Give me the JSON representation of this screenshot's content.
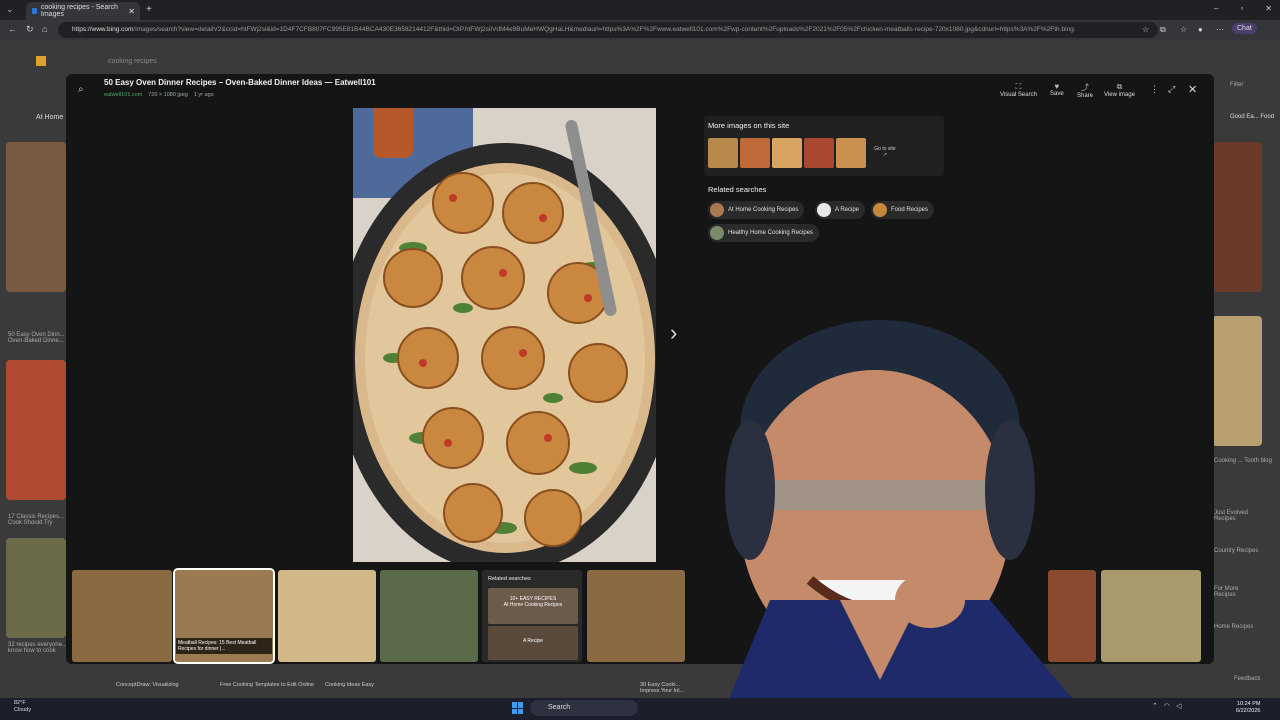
{
  "browser": {
    "tab_title": "cooking recipes - Search Images",
    "url_host": "https://www.bing.com",
    "url_path": "/images/search?view=detailV2&ccid=htFWj2si&id=1D4F7CFB807FC995E81B44BCA430E3658214412F&thid=OIP.htFWj2siIVdM4e9BuMeHWQgHaLH&mediaurl=https%3A%2F%2Fwww.eatwell101.com%2Fwp-content%2Fuploads%2F2021%2F05%2Fchicken-meatballs-recipe-720x1080.jpg&cdnurl=https%3A%2F%2Fth.bing.",
    "chat_label": "Chat"
  },
  "background_page": {
    "search_query": "cooking recipes",
    "left_items": [
      "At Home",
      "50 Easy Oven Dinn... Oven-Baked Dinne...",
      "17 Classic Recipes... Cook Should Try",
      "32 recipes everyone... know how to cook"
    ],
    "bottom_items": [
      "ConceptDraw: Visualizing",
      "Free Cooking Templates to Edit Online",
      "Cooking Ideas Easy",
      "30 Easy Cooki... Impress Your Inl..."
    ],
    "right_items": [
      "Good Ea... Food",
      "Cooking ... Tooth blog",
      "Just Evolved Recipes",
      "Country Recipes",
      "For More Recipes",
      "Home Recipes",
      "Feedback"
    ],
    "right_heading": "Filter"
  },
  "viewer": {
    "title": "50 Easy Oven Dinner Recipes – Oven-Baked Dinner Ideas — Eatwell101",
    "site": "eatwell101.com",
    "dimensions": "720 × 1080 jpeg",
    "age": "1 yr ago",
    "tools": [
      {
        "label": "Visual Search",
        "icon": "visual-search-icon"
      },
      {
        "label": "Save",
        "icon": "save-icon"
      },
      {
        "label": "Share",
        "icon": "share-icon"
      },
      {
        "label": "View image",
        "icon": "view-image-icon"
      }
    ],
    "more_images_title": "More images on this site",
    "go_to_site": "Go to site",
    "related_title": "Related searches",
    "related": [
      "At Home Cooking Recipes",
      "A Recipe",
      "Food Recipes",
      "Healthy Home Cooking Recipes"
    ],
    "strip_caption": "Meatball Recipes: 15 Best Meatball Recipes for dinner |...",
    "strip_related_title": "Related searches",
    "strip_related_a": "At Home Cooking Recipes",
    "strip_related_a_overlay": "10+ EASY RECIPES",
    "strip_related_b": "A Recipe"
  },
  "taskbar": {
    "weather_temp": "82°F",
    "weather_desc": "Cloudy",
    "search_label": "Search",
    "time": "10:24 PM",
    "date": "6/22/2026"
  },
  "colors": {
    "modal_bg": "#151515",
    "site_green": "#4ea86a",
    "accent_blue": "#3c9cf0"
  }
}
